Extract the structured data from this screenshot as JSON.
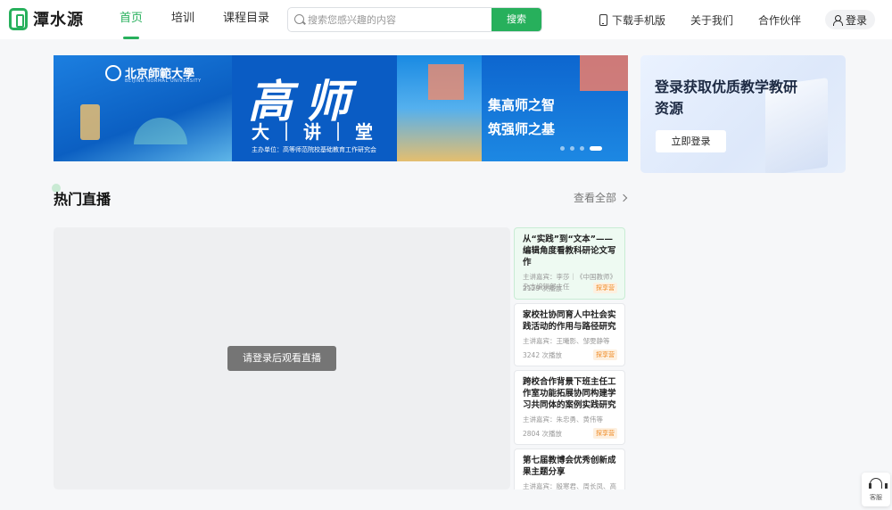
{
  "header": {
    "logo_text": "潭水源",
    "nav": [
      "首页",
      "培训",
      "课程目录"
    ],
    "search": {
      "placeholder": "搜索您感兴趣的内容",
      "button": "搜索"
    },
    "right_nav": [
      "下载手机版",
      "关于我们",
      "合作伙伴"
    ],
    "login": "登录"
  },
  "banner": {
    "university": "北京師範大學",
    "university_en": "BEIJING NORMAL UNIVERSITY",
    "title": "高师",
    "subtitle": "大｜讲｜堂",
    "host": "主办单位：高等师范院校基础教育工作研究会",
    "slogan1": "集高师之智",
    "slogan2": "筑强师之基",
    "slides": 5,
    "active_slide": 4
  },
  "login_card": {
    "title": "登录获取优质教学教研资源",
    "button": "立即登录"
  },
  "section": {
    "title": "热门直播",
    "view_all": "查看全部",
    "player_message": "请登录后观看直播",
    "items": [
      {
        "title": "从“实践”到“文本”——编辑角度看教科研论文写作",
        "speakers": "主讲嘉宾：李莎｜《中国教师》杂志编辑部主任",
        "plays": "2129 次播放",
        "tag": "探享营"
      },
      {
        "title": "家校社协同育人中社会实践活动的作用与路径研究",
        "speakers": "主讲嘉宾：王曦影、邹雯静等",
        "plays": "3242 次播放",
        "tag": "探享营"
      },
      {
        "title": "跨校合作背景下班主任工作室功能拓展协同构建学习共同体的案例实践研究",
        "speakers": "主讲嘉宾：朱忠勇、黄伟等",
        "plays": "2804 次播放",
        "tag": "探享营"
      },
      {
        "title": "第七届教博会优秀创新成果主题分享",
        "speakers": "主讲嘉宾：殷寒君、周长凤、高翔",
        "plays": "",
        "tag": ""
      }
    ]
  },
  "service": {
    "label": "客服"
  },
  "colors": {
    "brand": "#27b05c",
    "tag": "#f08a24"
  }
}
